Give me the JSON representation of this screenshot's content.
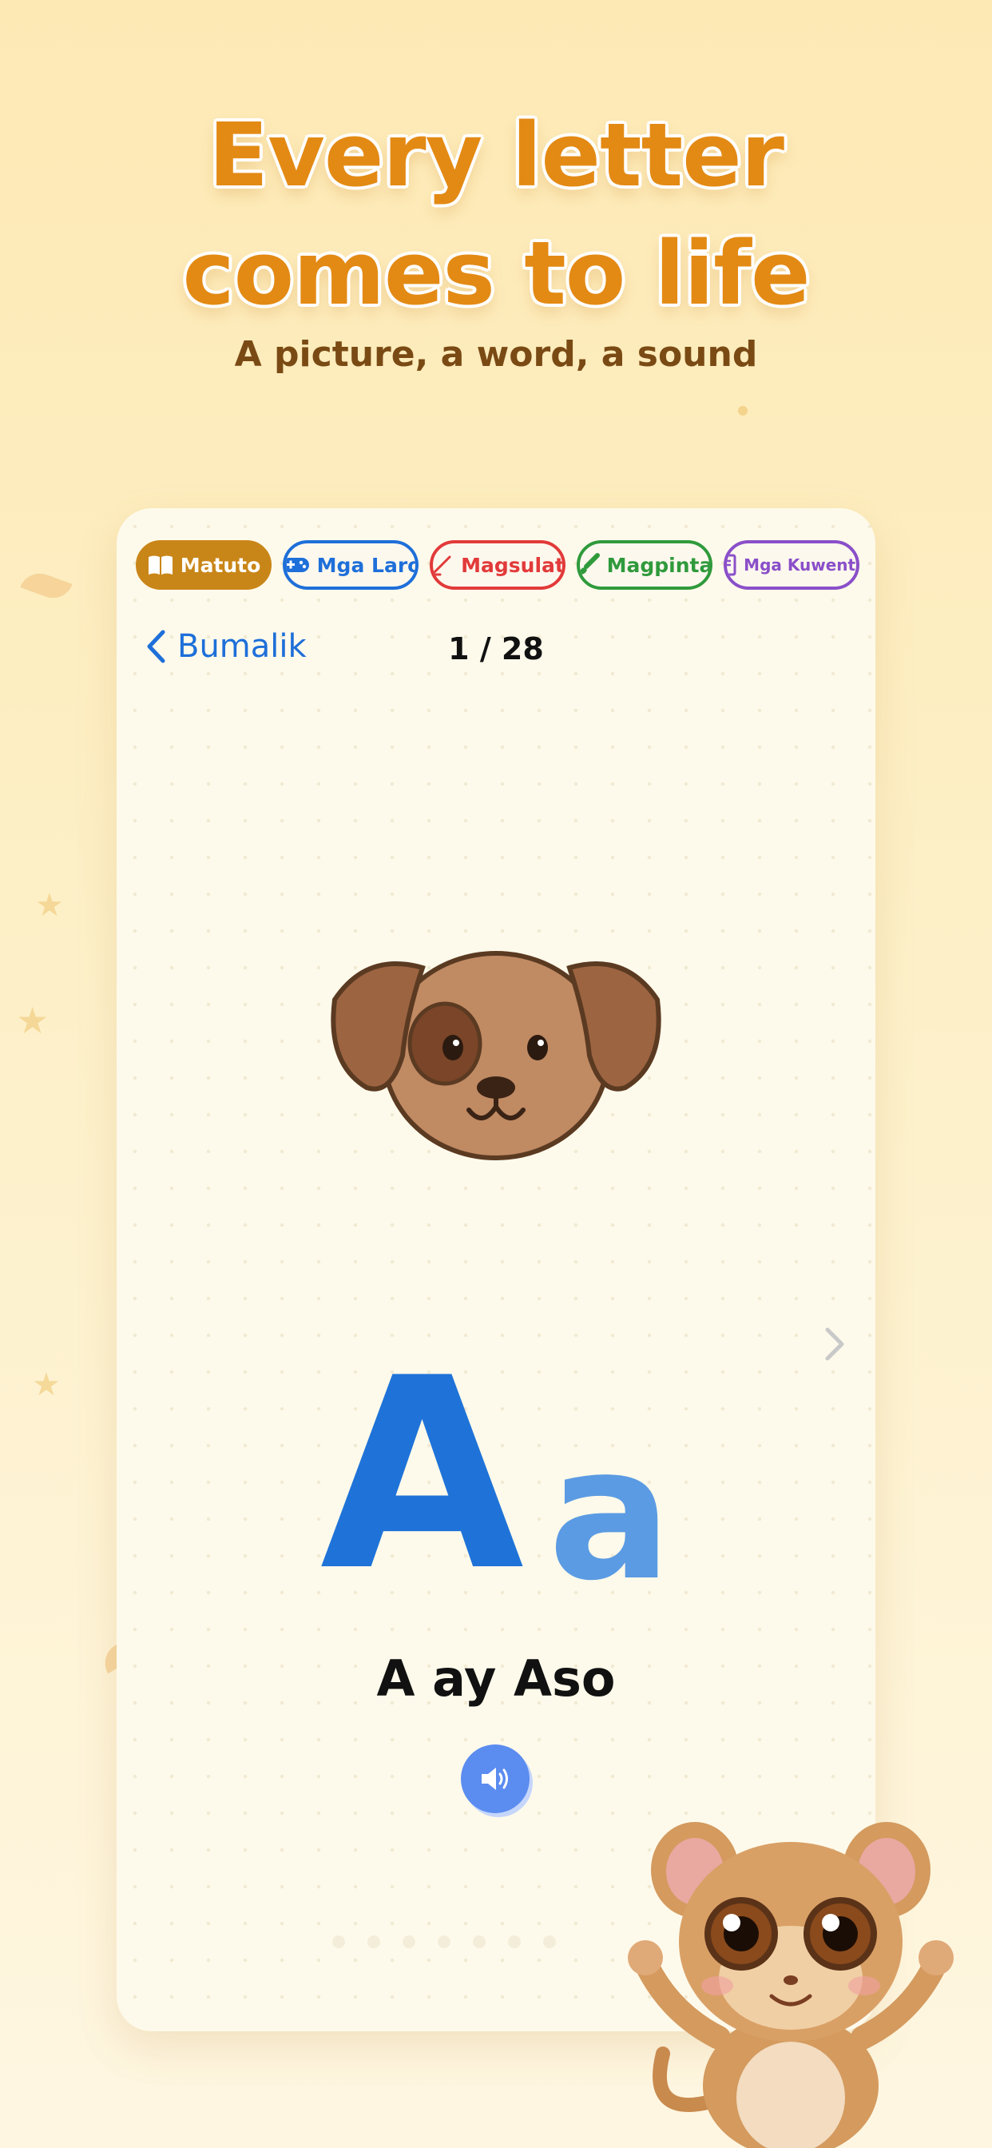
{
  "promo": {
    "headline_line1": "Every letter",
    "headline_line2": "comes to life",
    "subheadline": "A picture, a word, a sound"
  },
  "tabs": [
    {
      "label": "Matuto",
      "icon": "book-icon",
      "color": "#c98618",
      "active": true
    },
    {
      "label": "Mga Laro",
      "icon": "gamepad-icon",
      "color": "#1e6fd9",
      "active": false
    },
    {
      "label": "Magsulat",
      "icon": "pencil-icon",
      "color": "#e23a3a",
      "active": false
    },
    {
      "label": "Magpinta",
      "icon": "paintbrush-icon",
      "color": "#2f9a3c",
      "active": false
    },
    {
      "label": "Mga Kuwento",
      "icon": "storybook-icon",
      "color": "#8a4fc9",
      "active": false
    }
  ],
  "nav": {
    "back_label": "Bumalik",
    "counter": "1 / 28"
  },
  "lesson": {
    "image": "dog-face-icon",
    "letter_upper": "A",
    "letter_lower": "a",
    "word_phrase": "A ay Aso",
    "sound_icon": "speaker-icon",
    "next_icon": "chevron-right-icon"
  },
  "mascot": "tarsier-mascot",
  "colors": {
    "accent_orange": "#e38a14",
    "brand_blue": "#1f73d8",
    "card_bg": "#fefaeb"
  }
}
